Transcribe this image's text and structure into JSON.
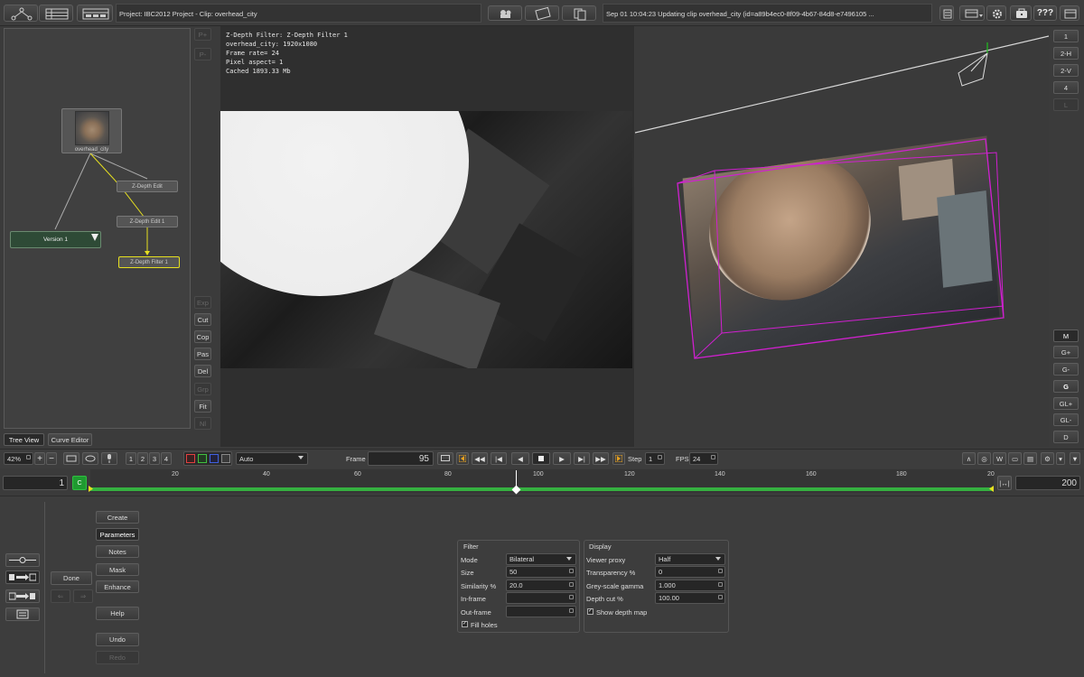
{
  "topbar": {
    "project": "Project: IBC2012 Project - Clip: overhead_city",
    "status": "Sep 01 10:04:23 Updating clip overhead_city (id=a89b4ec0-8f09-4b67-84d8-e7496105 ...",
    "help_label": "???"
  },
  "nodes": {
    "source": "overhead_city",
    "edit1": "Z-Depth Edit",
    "edit2": "Z-Depth Edit 1",
    "filter": "Z-Depth Filter 1",
    "version": "Version 1"
  },
  "tabs": {
    "tree_view": "Tree View",
    "curve_editor": "Curve Editor"
  },
  "side_tools": {
    "p_plus": "P+",
    "p_minus": "P-",
    "exp": "Exp",
    "cut": "Cut",
    "cop": "Cop",
    "pas": "Pas",
    "del": "Del",
    "grp": "Grp",
    "fit": "Fit",
    "nl": "Nl"
  },
  "viewer_info": {
    "line1": "Z-Depth Filter: Z-Depth Filter 1",
    "line2": "overhead_city: 1920x1080",
    "line3": "Frame rate= 24",
    "line4": "Pixel aspect= 1",
    "line5": "Cached 1893.33 Mb"
  },
  "view_modes": {
    "v1": "1",
    "v2h": "2-H",
    "v2v": "2-V",
    "v4": "4",
    "vl": "L",
    "m": "M",
    "gplus": "G+",
    "gminus": "G-",
    "g": "G",
    "glplus": "GL+",
    "glminus": "GL-",
    "d": "D"
  },
  "controls": {
    "zoom": "42%",
    "presets": [
      "1",
      "2",
      "3",
      "4"
    ],
    "channel": "Auto",
    "frame_label": "Frame",
    "frame_value": "95",
    "step_label": "Step",
    "step_value": "1",
    "fps_label": "FPS",
    "fps_value": "24"
  },
  "timeline": {
    "start": "1",
    "end": "200",
    "marker": "C",
    "ticks": [
      "20",
      "40",
      "60",
      "80",
      "100",
      "120",
      "140",
      "160",
      "180",
      "20"
    ]
  },
  "left_buttons": {
    "done": "Done",
    "create": "Create",
    "parameters": "Parameters",
    "notes": "Notes",
    "mask": "Mask",
    "enhance": "Enhance",
    "help": "Help",
    "undo": "Undo",
    "redo": "Redo"
  },
  "filter_panel": {
    "title": "Filter",
    "mode_label": "Mode",
    "mode_value": "Bilateral",
    "size_label": "Size",
    "size_value": "50",
    "similarity_label": "Similarity %",
    "similarity_value": "20.0",
    "inframe_label": "In-frame",
    "outframe_label": "Out-frame",
    "fill_holes": "Fill holes"
  },
  "display_panel": {
    "title": "Display",
    "proxy_label": "Viewer proxy",
    "proxy_value": "Half",
    "transparency_label": "Transparency %",
    "transparency_value": "0",
    "gamma_label": "Grey-scale gamma",
    "gamma_value": "1.000",
    "depthcut_label": "Depth cut %",
    "depthcut_value": "100.00",
    "show_depth": "Show depth map"
  },
  "colors": {
    "accent_yellow": "#e6e020",
    "timeline_green": "#35b040",
    "gizmo_magenta": "#d020d0"
  }
}
